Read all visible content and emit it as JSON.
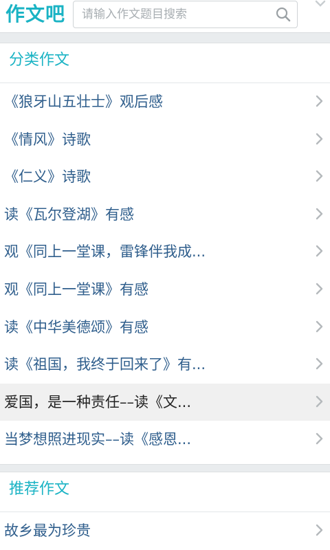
{
  "header": {
    "logo_text": "作文吧",
    "search_placeholder": "请输入作文题目搜索"
  },
  "classify": {
    "title": "分类作文",
    "items": [
      {
        "label": "《狼牙山五壮士》观后感"
      },
      {
        "label": "《情风》诗歌"
      },
      {
        "label": "《仁义》诗歌"
      },
      {
        "label": "读《瓦尔登湖》有感"
      },
      {
        "label": "观《同上一堂课，雷锋伴我成..."
      },
      {
        "label": "观《同上一堂课》有感"
      },
      {
        "label": "读《中华美德颂》有感"
      },
      {
        "label": "读《祖国，我终于回来了》有..."
      },
      {
        "label": "爱国，是一种责任––读《文..."
      },
      {
        "label": "当梦想照进现实––读《感恩..."
      }
    ]
  },
  "recommend": {
    "title": "推荐作文",
    "items": [
      {
        "label": "故乡最为珍贵"
      }
    ]
  },
  "colors": {
    "accent": "#1ab3c4",
    "link_text": "#2f5e8c",
    "background": "#e9ecee"
  }
}
